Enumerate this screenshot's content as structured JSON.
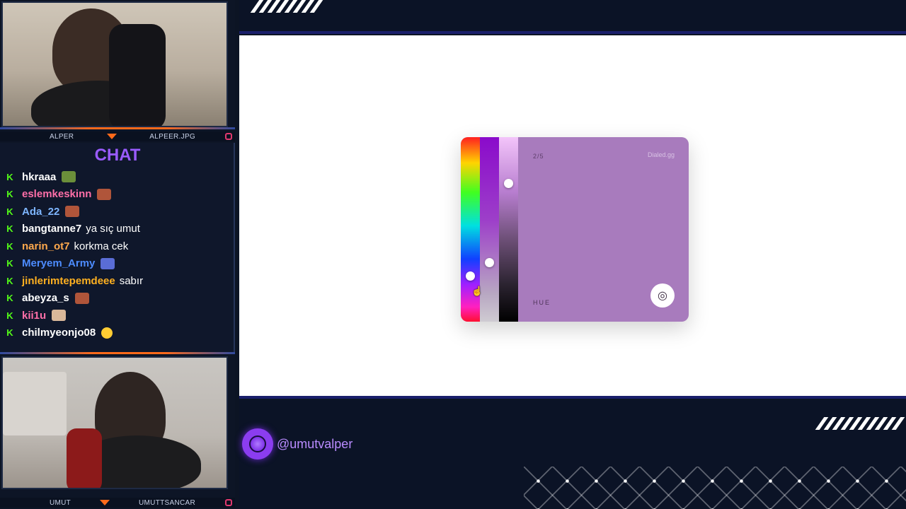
{
  "cams": {
    "top": {
      "left_label": "ALPER",
      "right_label": "ALPEER.JPG"
    },
    "bottom": {
      "left_label": "UMUT",
      "right_label": "UMUTTSANCAR"
    }
  },
  "chat": {
    "title": "CHAT",
    "badge": "K",
    "messages": [
      {
        "user": "hkraaa",
        "color": "#ffffff",
        "text": "",
        "emote": "frog-emote"
      },
      {
        "user": "eslemkeskinn",
        "color": "#ff6fa8",
        "text": "",
        "emote": "face-emote"
      },
      {
        "user": "Ada_22",
        "color": "#7eb6ff",
        "text": "",
        "emote": "face-emote"
      },
      {
        "user": "bangtanne7",
        "color": "#ffffff",
        "text": "ya sıç umut",
        "emote": ""
      },
      {
        "user": "narin_ot7",
        "color": "#ffa94d",
        "text": "korkma cek",
        "emote": ""
      },
      {
        "user": "Meryem_Army",
        "color": "#4d8cff",
        "text": "",
        "emote": "banner-emote"
      },
      {
        "user": "jinlerimtepemdeee",
        "color": "#ffb020",
        "text": "sabır",
        "emote": ""
      },
      {
        "user": "abeyza_s",
        "color": "#ffffff",
        "text": "",
        "emote": "face-emote"
      },
      {
        "user": "kii1u",
        "color": "#ff6fa8",
        "text": "",
        "emote": "cat-emote"
      },
      {
        "user": "chilmyeonjo08",
        "color": "#ffffff",
        "text": "",
        "emote": "eyeroll-emote"
      }
    ]
  },
  "game": {
    "round": "2/5",
    "brand": "Dialed.gg",
    "mode_label": "HUE",
    "submit_icon": "target-icon",
    "selected_color": "#a87bbd"
  },
  "social": {
    "handle": "@umutvalper",
    "icon": "globe-icon"
  }
}
